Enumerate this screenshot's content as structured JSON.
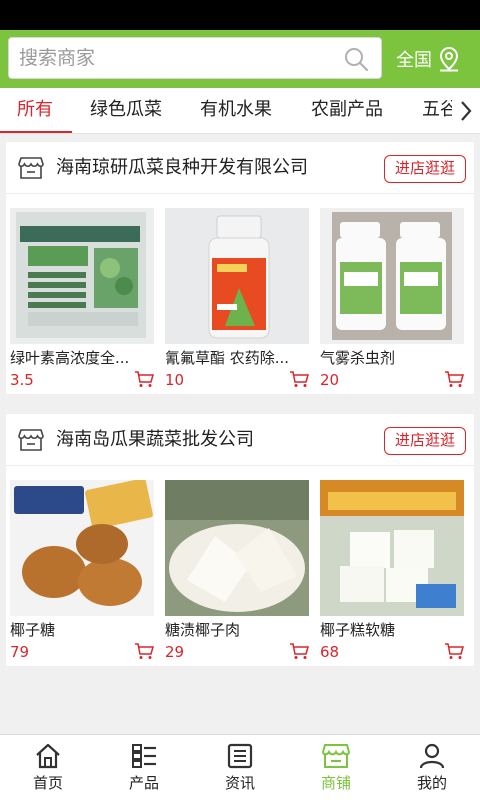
{
  "search": {
    "placeholder": "搜索商家"
  },
  "region": {
    "label": "全国"
  },
  "tabs": [
    {
      "label": "所有",
      "active": true
    },
    {
      "label": "绿色瓜菜",
      "active": false
    },
    {
      "label": "有机水果",
      "active": false
    },
    {
      "label": "农副产品",
      "active": false
    },
    {
      "label": "五谷",
      "active": false
    }
  ],
  "shops": [
    {
      "name": "海南琼研瓜菜良种开发有限公司",
      "visit_label": "进店逛逛",
      "products": [
        {
          "name": "绿叶素高浓度全...",
          "price": "3.5"
        },
        {
          "name": "氰氟草酯 农药除...",
          "price": "10"
        },
        {
          "name": "气雾杀虫剂",
          "price": "20"
        }
      ]
    },
    {
      "name": "海南岛瓜果蔬菜批发公司",
      "visit_label": "进店逛逛",
      "products": [
        {
          "name": "椰子糖",
          "price": "79"
        },
        {
          "name": "糖渍椰子肉",
          "price": "29"
        },
        {
          "name": "椰子糕软糖",
          "price": "68"
        }
      ]
    }
  ],
  "bottom_nav": [
    {
      "label": "首页",
      "icon": "home-icon",
      "active": false
    },
    {
      "label": "产品",
      "icon": "list-icon",
      "active": false
    },
    {
      "label": "资讯",
      "icon": "news-icon",
      "active": false
    },
    {
      "label": "商铺",
      "icon": "store-icon",
      "active": true
    },
    {
      "label": "我的",
      "icon": "user-icon",
      "active": false
    }
  ],
  "colors": {
    "brand_green": "#7cc33e",
    "accent_red": "#d9262b"
  }
}
